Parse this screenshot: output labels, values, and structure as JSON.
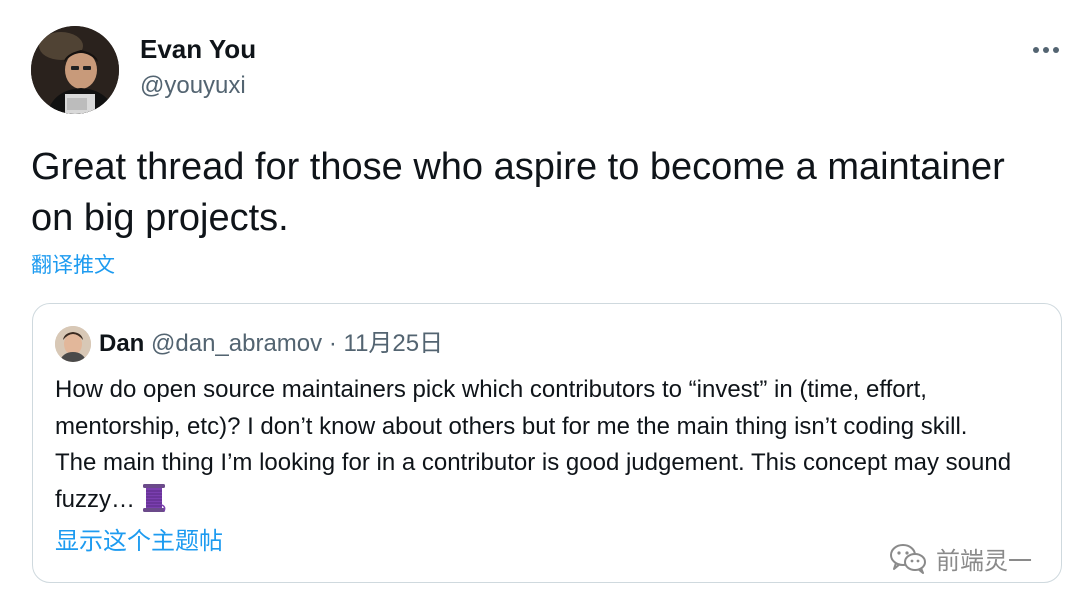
{
  "tweet": {
    "author": {
      "name": "Evan You",
      "handle": "@youyuxi"
    },
    "text": "Great thread for those who aspire to become a maintainer on big projects.",
    "translate_label": "翻译推文",
    "more_icon": "more-horizontal-icon"
  },
  "quoted_tweet": {
    "author": {
      "name": "Dan",
      "handle": "@dan_abramov"
    },
    "separator": "·",
    "date": "11月25日",
    "text": "How do open source maintainers pick which contributors to “invest” in (time, effort, mentorship, etc)? I don’t know about others but for me the main thing isn’t coding skill. The main thing I’m looking for in a contributor is good judgement. This concept may sound fuzzy…",
    "emoji_icon": "thread-spool-icon",
    "show_thread_label": "显示这个主题帖"
  },
  "watermark": {
    "icon": "wechat-icon",
    "text": "前端灵一"
  },
  "colors": {
    "link": "#1d9bf0",
    "secondary_text": "#536471",
    "border": "#cfd9de",
    "primary_text": "#0f1419"
  }
}
